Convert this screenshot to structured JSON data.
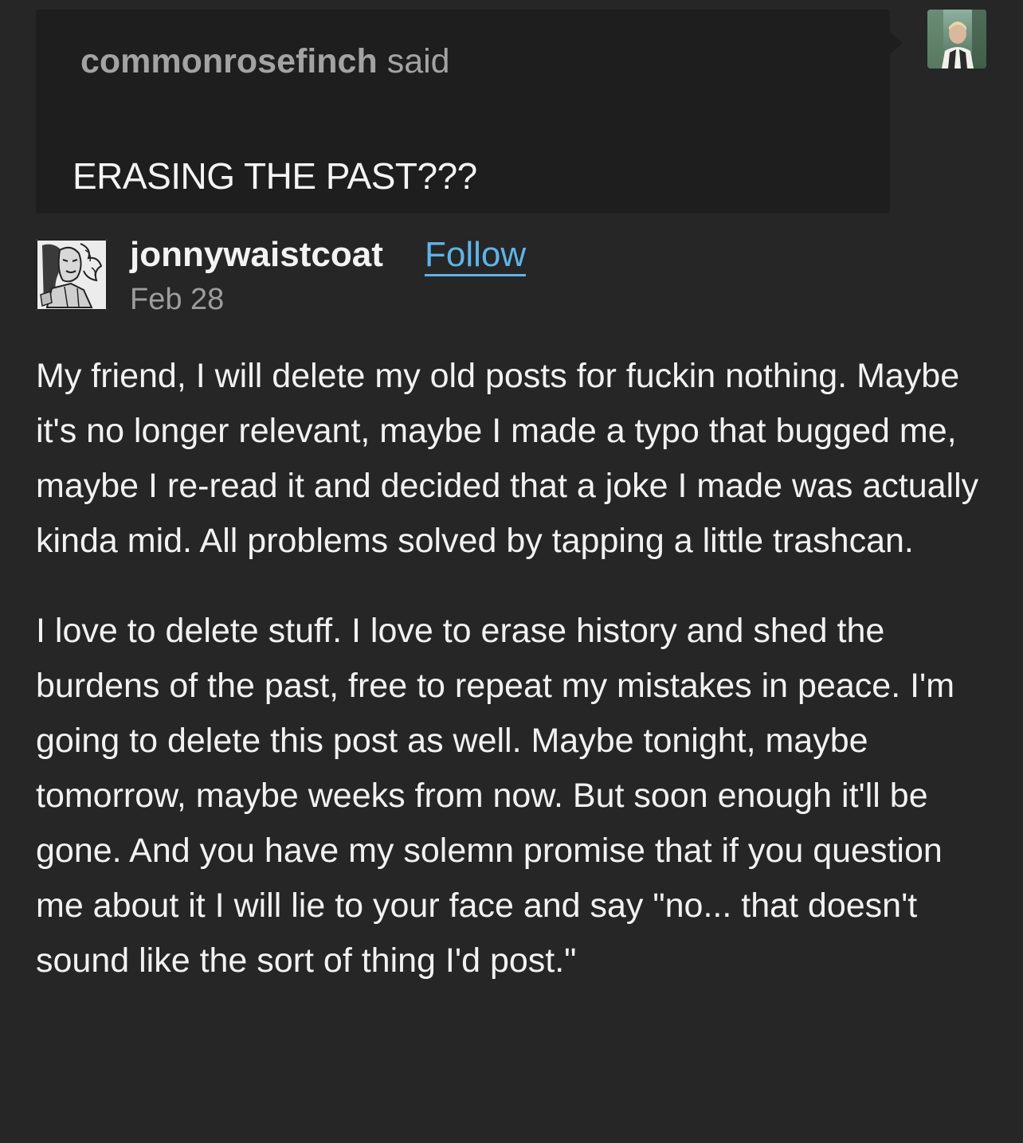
{
  "ask": {
    "asker": "commonrosefinch",
    "said": "said",
    "text": "ERASING THE PAST???"
  },
  "answer": {
    "username": "jonnywaistcoat",
    "follow_label": "Follow",
    "date": "Feb 28",
    "paragraphs": [
      "My friend, I will delete my old posts for fuckin nothing. Maybe it's no longer relevant, maybe I made a typo that bugged me, maybe I re-read it and decided that a joke I made was actually kinda mid. All problems solved by tapping a little trashcan.",
      "I love to delete stuff. I love to erase history and shed the burdens of the past, free to repeat my mistakes in peace. I'm going to delete this post as well. Maybe tonight, maybe tomorrow, maybe weeks from now. But soon enough it'll be gone. And you have my solemn promise that if you question me about it I will lie to your face and say \"no... that doesn't sound like the sort of thing I'd post.\""
    ]
  },
  "colors": {
    "background": "#262626",
    "ask_bubble": "#1e1e1e",
    "link": "#5fb4e8",
    "muted_text": "#9d9d9d"
  }
}
